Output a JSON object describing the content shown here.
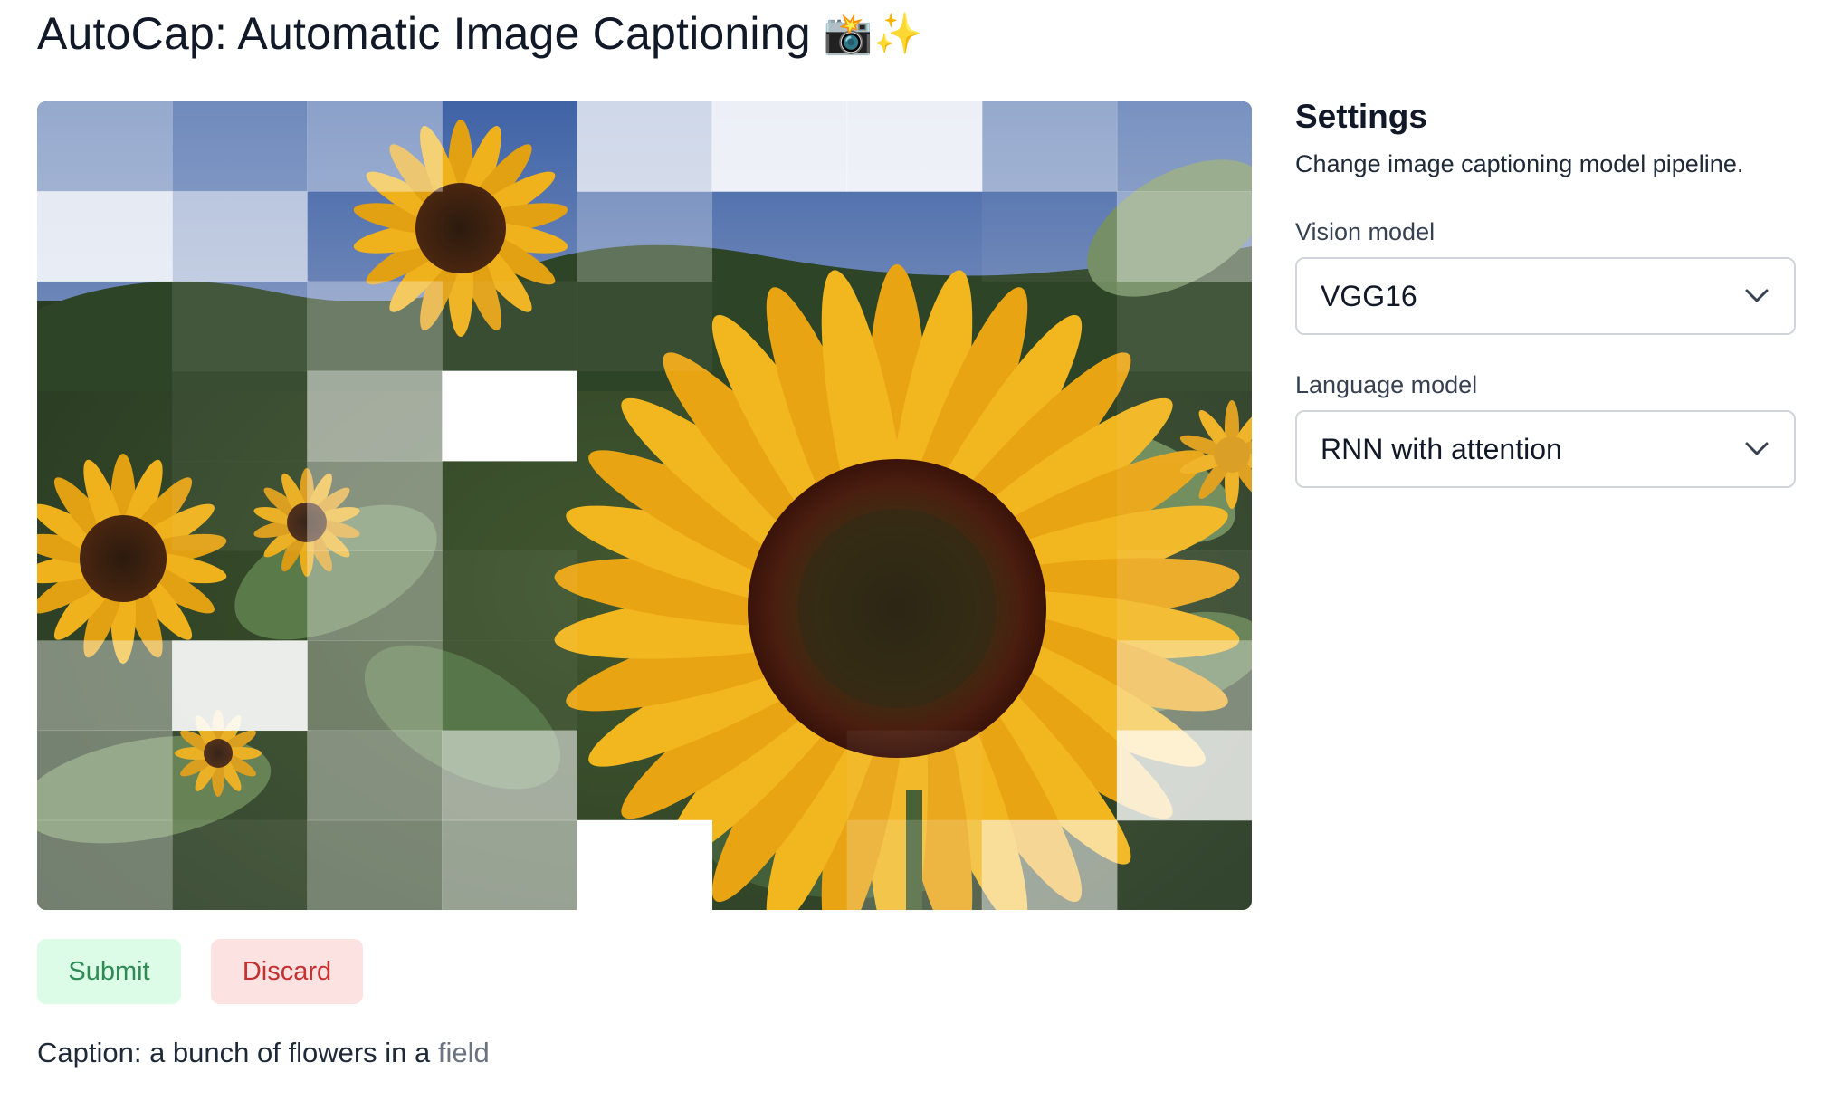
{
  "app": {
    "title": "AutoCap: Automatic Image Captioning",
    "title_emoji": "📸✨"
  },
  "image": {
    "subject_icon": "sunflower-photo"
  },
  "actions": {
    "submit_label": "Submit",
    "discard_label": "Discard"
  },
  "caption": {
    "prefix": "Caption: a bunch of flowers in a",
    "suffix": "field"
  },
  "settings": {
    "title": "Settings",
    "description": "Change image captioning model pipeline.",
    "vision_label": "Vision model",
    "vision_value": "VGG16",
    "language_label": "Language model",
    "language_value": "RNN with attention"
  },
  "colors": {
    "submit_bg": "#dcfce7",
    "submit_text": "#2f8a55",
    "discard_bg": "#fde2e2",
    "discard_text": "#c53030"
  }
}
